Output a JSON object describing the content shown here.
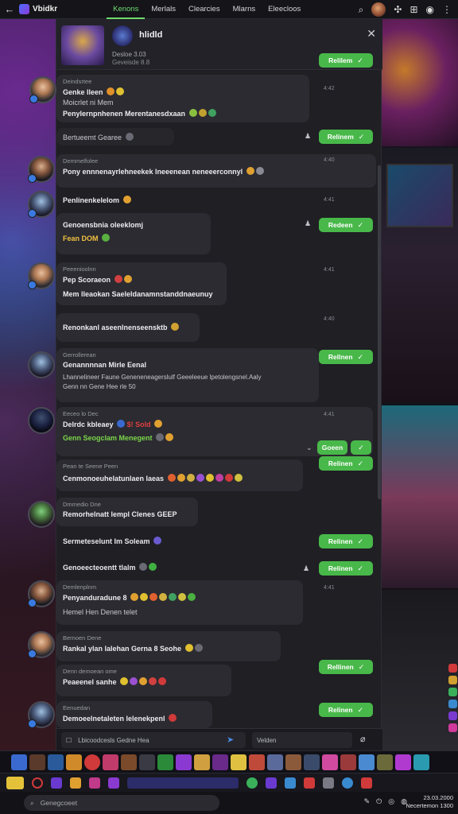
{
  "topbar": {
    "back_icon": "arrow-left-icon",
    "app_name": "Vbidkr",
    "tabs": [
      {
        "label": "Kenons",
        "active": true
      },
      {
        "label": "Merlals",
        "active": false
      },
      {
        "label": "Clearcies",
        "active": false
      },
      {
        "label": "Mlarns",
        "active": false
      },
      {
        "label": "Eleecloos",
        "active": false
      }
    ],
    "icons": [
      "search-icon",
      "avatar",
      "gamepad-icon",
      "grid-icon",
      "globe-icon",
      "more-icon"
    ]
  },
  "chat": {
    "group_name": "hlidld",
    "group_sub": "Desloe  3.03",
    "group_sub2": "Geveisde  8.8",
    "close_icon": "close-icon",
    "messages": [
      {
        "name": "Deindsrtee",
        "lines": [
          "Genke lleen",
          "Moicrlet  ni  Mem",
          "Penylernpnhenen Merentanesdxaan"
        ],
        "time": "4:42",
        "reply": "Relilem"
      },
      {
        "name": "Remeeen  3:ee",
        "lines": [
          "Bertueemt  Gearee"
        ],
        "time": "4:40",
        "reply": "Relinem"
      },
      {
        "name": "Demmelfolee",
        "lines": [
          "Pony ennnenayrlehneekek lneeenean neneeerconnyl"
        ],
        "time": "4:40"
      },
      {
        "name": "",
        "lines": [
          "Penlinenkelelom"
        ],
        "time": "4:41",
        "reply": "Redeen"
      },
      {
        "name": "",
        "lines": [
          "Genoensbnia oleeklomj",
          "Fean  DOM"
        ],
        "time": "4:43"
      },
      {
        "name": "Peeenioolnn",
        "lines": [
          "Pep  Scoraeon",
          "Mem  lleaokan  Saeleldanamnstanddnaeunuy"
        ],
        "time": "4:41"
      },
      {
        "name": "",
        "lines": [
          "Renonkanl  aseenlnenseensktb"
        ],
        "time": "4:40"
      },
      {
        "name": "Gerrollerean",
        "lines": [
          "Genannnnan  Mirle  Eenal",
          "Lhannelineer  Faune  Geneneneagerslulf  Geeeleeue  lpetolengsnel.Aaly",
          "Genn  nn  Gene  Hee  rle  50"
        ],
        "time": "4:41",
        "reply": "Rellnen"
      },
      {
        "name": "Eeceo lo  Dec",
        "lines": [
          "Delrdc  kbleaey",
          "Genn  Seogclam  Menegent"
        ],
        "time": "4:41",
        "reply": "Goeen",
        "reply2": "Relinen"
      },
      {
        "name": "Pean  te  Seene  Peen",
        "lines": [
          "Cenmonoeuhelatunlaen  laeas"
        ],
        "time": "4:42"
      },
      {
        "name": "Dmmedio  Dne",
        "lines": [
          "Remorhelnatt  lempl  Clenes  GEEP"
        ],
        "time": "4:41"
      },
      {
        "name": "",
        "lines": [
          "Sermeteselunt  Im  Soleam"
        ],
        "time": "4:41",
        "reply": "Relinen"
      },
      {
        "name": "",
        "lines": [
          "Genoeecteoentt  tlalm"
        ],
        "time": "4:41",
        "reply": "Relinen"
      },
      {
        "name": "Demlenplnm",
        "lines": [
          "Penyanduradune  8",
          "Hemel  Hen  Denen  telet"
        ],
        "time": "4:41"
      },
      {
        "name": "Bernoen  Dene",
        "lines": [
          "Rankal  ylan  lalehan  Gerna  8  Seohe"
        ],
        "time": "4:39",
        "reply": "Rellinen"
      },
      {
        "name": "Denn  demoean  ome",
        "lines": [
          "Peaeenel  sanhe"
        ],
        "time": "4:40"
      },
      {
        "name": "Eenuedan",
        "lines": [
          "Demoeelnetaleten  lelenekpenl"
        ],
        "time": "4:41",
        "reply": "Relinen"
      }
    ],
    "composer": {
      "placeholder": "Lbicoodcesls  Gedne  Hea",
      "placeholder2": "Velden"
    }
  },
  "taskbar": {
    "search_placeholder": "Genegcoeet",
    "time": "23.03.2000",
    "date": "Necertemon  1300"
  },
  "colors": {
    "accent_green": "#49b84a",
    "tab_active": "#6fdc6f",
    "bubble": "#2b2b31",
    "panel": "#1f1f24"
  }
}
